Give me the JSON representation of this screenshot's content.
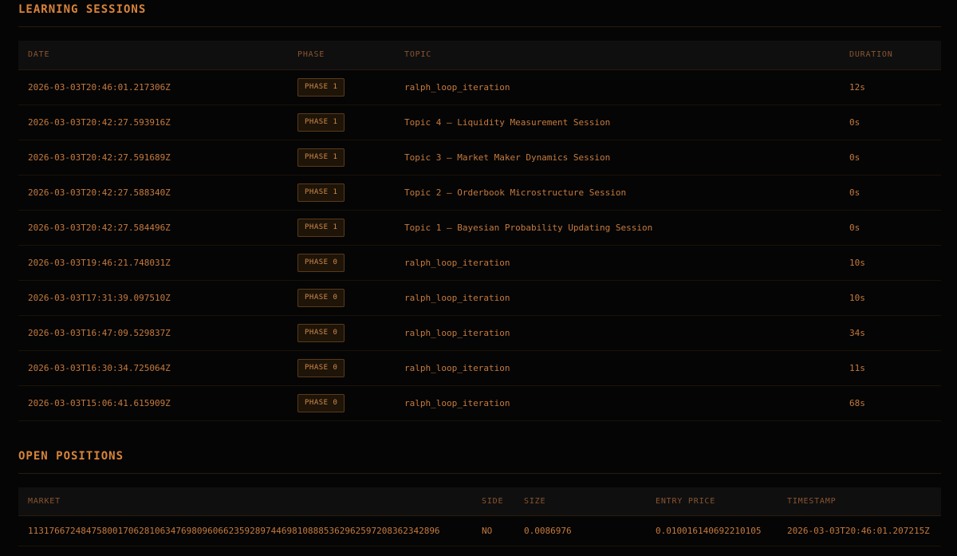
{
  "learning_sessions": {
    "title": "LEARNING SESSIONS",
    "columns": [
      "DATE",
      "PHASE",
      "TOPIC",
      "DURATION"
    ],
    "rows": [
      {
        "date": "2026-03-03T20:46:01.217306Z",
        "phase": "PHASE 1",
        "topic": "ralph_loop_iteration",
        "duration": "12s"
      },
      {
        "date": "2026-03-03T20:42:27.593916Z",
        "phase": "PHASE 1",
        "topic": "Topic 4 — Liquidity Measurement Session",
        "duration": "0s"
      },
      {
        "date": "2026-03-03T20:42:27.591689Z",
        "phase": "PHASE 1",
        "topic": "Topic 3 — Market Maker Dynamics Session",
        "duration": "0s"
      },
      {
        "date": "2026-03-03T20:42:27.588340Z",
        "phase": "PHASE 1",
        "topic": "Topic 2 — Orderbook Microstructure Session",
        "duration": "0s"
      },
      {
        "date": "2026-03-03T20:42:27.584496Z",
        "phase": "PHASE 1",
        "topic": "Topic 1 — Bayesian Probability Updating Session",
        "duration": "0s"
      },
      {
        "date": "2026-03-03T19:46:21.748031Z",
        "phase": "PHASE 0",
        "topic": "ralph_loop_iteration",
        "duration": "10s"
      },
      {
        "date": "2026-03-03T17:31:39.097510Z",
        "phase": "PHASE 0",
        "topic": "ralph_loop_iteration",
        "duration": "10s"
      },
      {
        "date": "2026-03-03T16:47:09.529837Z",
        "phase": "PHASE 0",
        "topic": "ralph_loop_iteration",
        "duration": "34s"
      },
      {
        "date": "2026-03-03T16:30:34.725064Z",
        "phase": "PHASE 0",
        "topic": "ralph_loop_iteration",
        "duration": "11s"
      },
      {
        "date": "2026-03-03T15:06:41.615909Z",
        "phase": "PHASE 0",
        "topic": "ralph_loop_iteration",
        "duration": "68s"
      }
    ]
  },
  "open_positions": {
    "title": "OPEN POSITIONS",
    "columns": [
      "MARKET",
      "SIDE",
      "SIZE",
      "ENTRY PRICE",
      "TIMESTAMP"
    ],
    "rows": [
      {
        "market": "113176672484758001706281063476980960662359289744698108885362962597208362342896",
        "side": "NO",
        "size": "0.0086976",
        "entry_price": "0.010016140692210105",
        "timestamp": "2026-03-03T20:46:01.207215Z"
      }
    ]
  },
  "colors": {
    "background": "#050505",
    "accent": "#d8843a",
    "text": "#c57a3e",
    "header_text": "#8a5530"
  }
}
